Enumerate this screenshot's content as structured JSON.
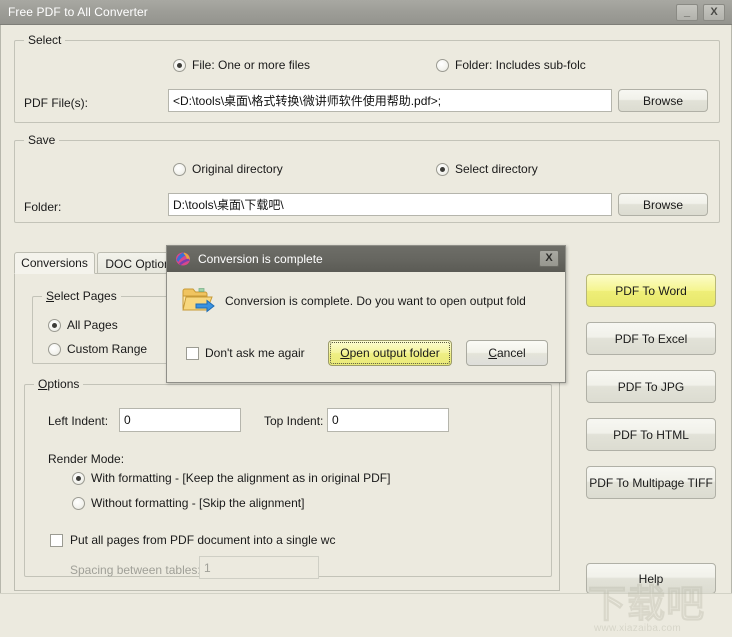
{
  "window": {
    "title": "Free PDF to All Converter",
    "minimize_label": "_",
    "close_label": "X"
  },
  "select_group": {
    "title": "Select",
    "source_options": [
      {
        "label": "File:  One or more files",
        "checked": true
      },
      {
        "label": "Folder: Includes sub-folc",
        "checked": false
      }
    ],
    "file_label": "PDF File(s):",
    "file_value": "<D:\\tools\\桌面\\格式转换\\微讲师软件使用帮助.pdf>;",
    "browse_label": "Browse"
  },
  "save_group": {
    "title": "Save",
    "dir_options": [
      {
        "label": "Original directory",
        "checked": false
      },
      {
        "label": "Select directory",
        "checked": true
      }
    ],
    "folder_label": "Folder:",
    "folder_value": "D:\\tools\\桌面\\下载吧\\",
    "browse_label": "Browse"
  },
  "tabs": [
    {
      "label": "Conversions",
      "active": true
    },
    {
      "label": "DOC Option",
      "active": false
    }
  ],
  "pages_group": {
    "title": "Select Pages",
    "title_mnemonic": "S",
    "options": [
      {
        "label": "All Pages",
        "checked": true
      },
      {
        "label": "Custom Range",
        "checked": false
      }
    ]
  },
  "options_group": {
    "title": "Options",
    "title_mnemonic": "O",
    "left_indent_label": "Left Indent:",
    "left_indent_value": "0",
    "top_indent_label": "Top Indent:",
    "top_indent_value": "0",
    "render_mode_label": "Render Mode:",
    "render_modes": [
      {
        "label": "With formatting - [Keep the alignment as in original PDF]",
        "checked": true
      },
      {
        "label": "Without formatting - [Skip the alignment]",
        "checked": false
      }
    ],
    "single_doc_label": "Put all pages from PDF document into a single wc",
    "single_doc_checked": false,
    "spacing_label": "Spacing between tables:",
    "spacing_value": "1"
  },
  "action_buttons": [
    {
      "label": "PDF To Word",
      "highlighted": true
    },
    {
      "label": "PDF To Excel",
      "highlighted": false
    },
    {
      "label": "PDF To JPG",
      "highlighted": false
    },
    {
      "label": "PDF To HTML",
      "highlighted": false
    },
    {
      "label": "PDF To Multipage TIFF",
      "highlighted": false
    }
  ],
  "help_button": {
    "label": "Help"
  },
  "dialog": {
    "title": "Conversion is complete",
    "close_label": "X",
    "message": "Conversion is complete. Do you want to open output fold",
    "dont_ask_label": "Don't ask me agair",
    "dont_ask_checked": false,
    "primary_label": "Open output folder",
    "primary_mnemonic": "O",
    "primary_rest": "pen output folder",
    "secondary_label": "Cancel",
    "secondary_mnemonic": "C",
    "secondary_rest": "ancel"
  },
  "watermark": {
    "text": "下载吧",
    "url": "www.xiazaiba.com"
  },
  "colors": {
    "window_bg": "#eceadf",
    "titlebar": "#9d9d97",
    "accent_yellow": "#f0f080",
    "dialog_titlebar": "#65655f"
  }
}
